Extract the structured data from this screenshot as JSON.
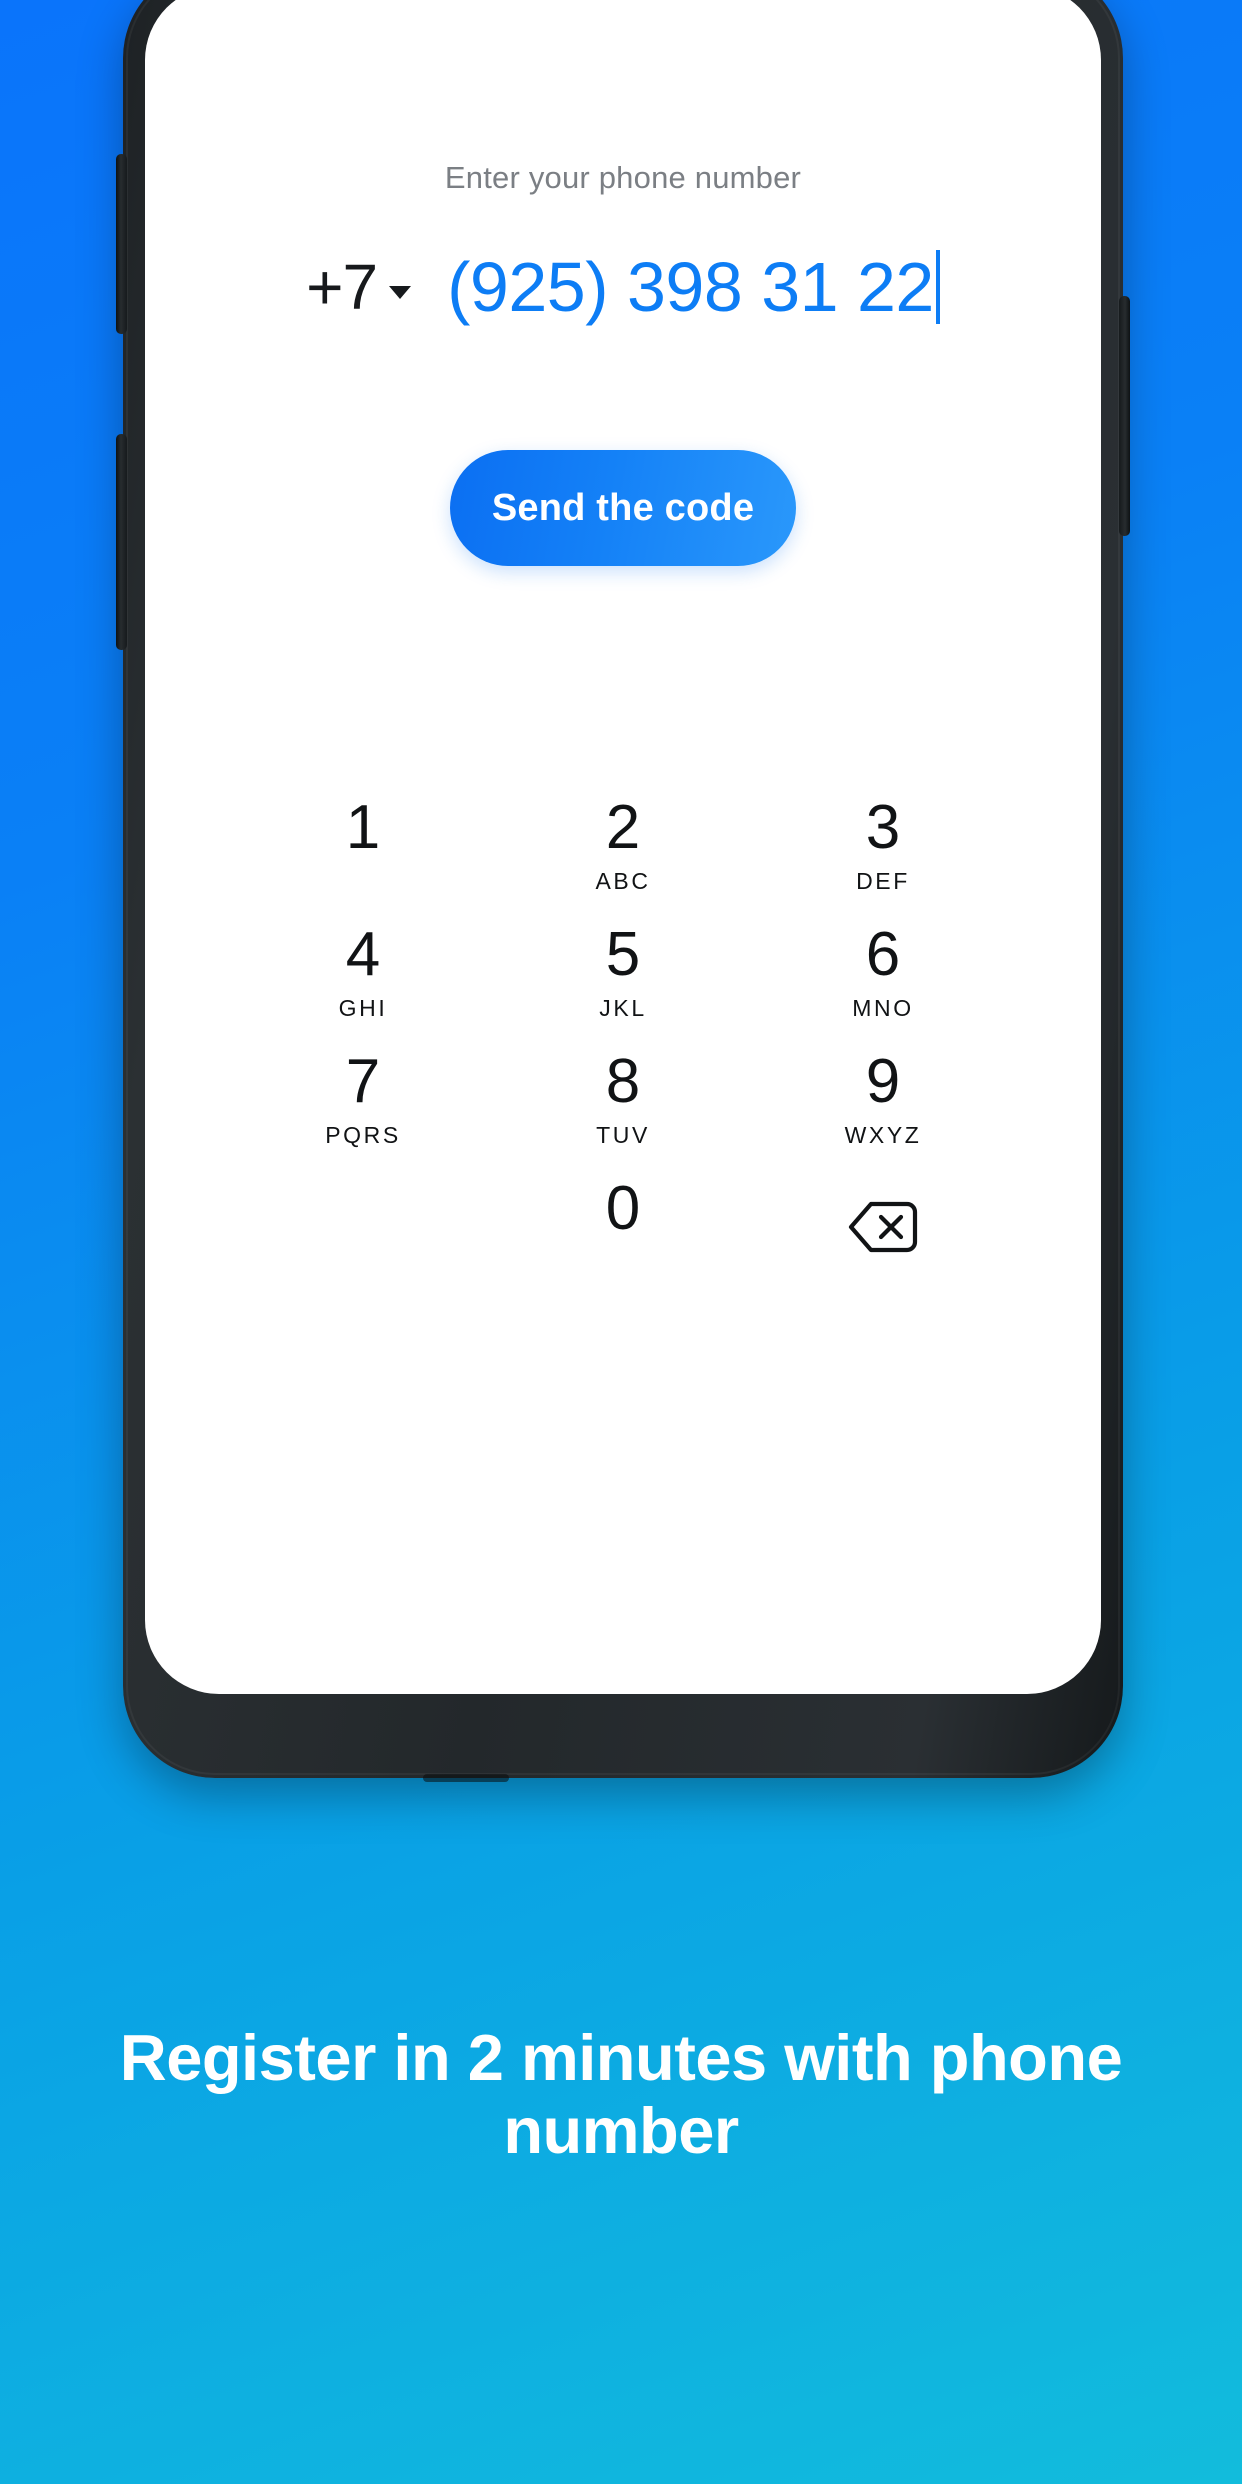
{
  "background": {
    "gradient_start": "#0a74fb",
    "gradient_end": "#12bcdc"
  },
  "phone_screen": {
    "hint_label": "Enter your phone number",
    "country_code": "+7",
    "country_code_dropdown_icon": "chevron-down-icon",
    "phone_number": "(925) 398 31 22",
    "phone_number_color": "#0d7df5",
    "send_button_label": "Send the code",
    "send_button_color": "#1481f7",
    "keypad": [
      {
        "digit": "1",
        "letters": ""
      },
      {
        "digit": "2",
        "letters": "ABC"
      },
      {
        "digit": "3",
        "letters": "DEF"
      },
      {
        "digit": "4",
        "letters": "GHI"
      },
      {
        "digit": "5",
        "letters": "JKL"
      },
      {
        "digit": "6",
        "letters": "MNO"
      },
      {
        "digit": "7",
        "letters": "PQRS"
      },
      {
        "digit": "8",
        "letters": "TUV"
      },
      {
        "digit": "9",
        "letters": "WXYZ"
      },
      {
        "digit": "",
        "letters": ""
      },
      {
        "digit": "0",
        "letters": ""
      },
      {
        "digit": "backspace-icon",
        "letters": ""
      }
    ]
  },
  "hardware": {
    "volume_up": "volume-up-button",
    "volume_down": "volume-down-button",
    "power": "power-button"
  },
  "caption": {
    "text": "Register in 2 minutes with phone number"
  }
}
